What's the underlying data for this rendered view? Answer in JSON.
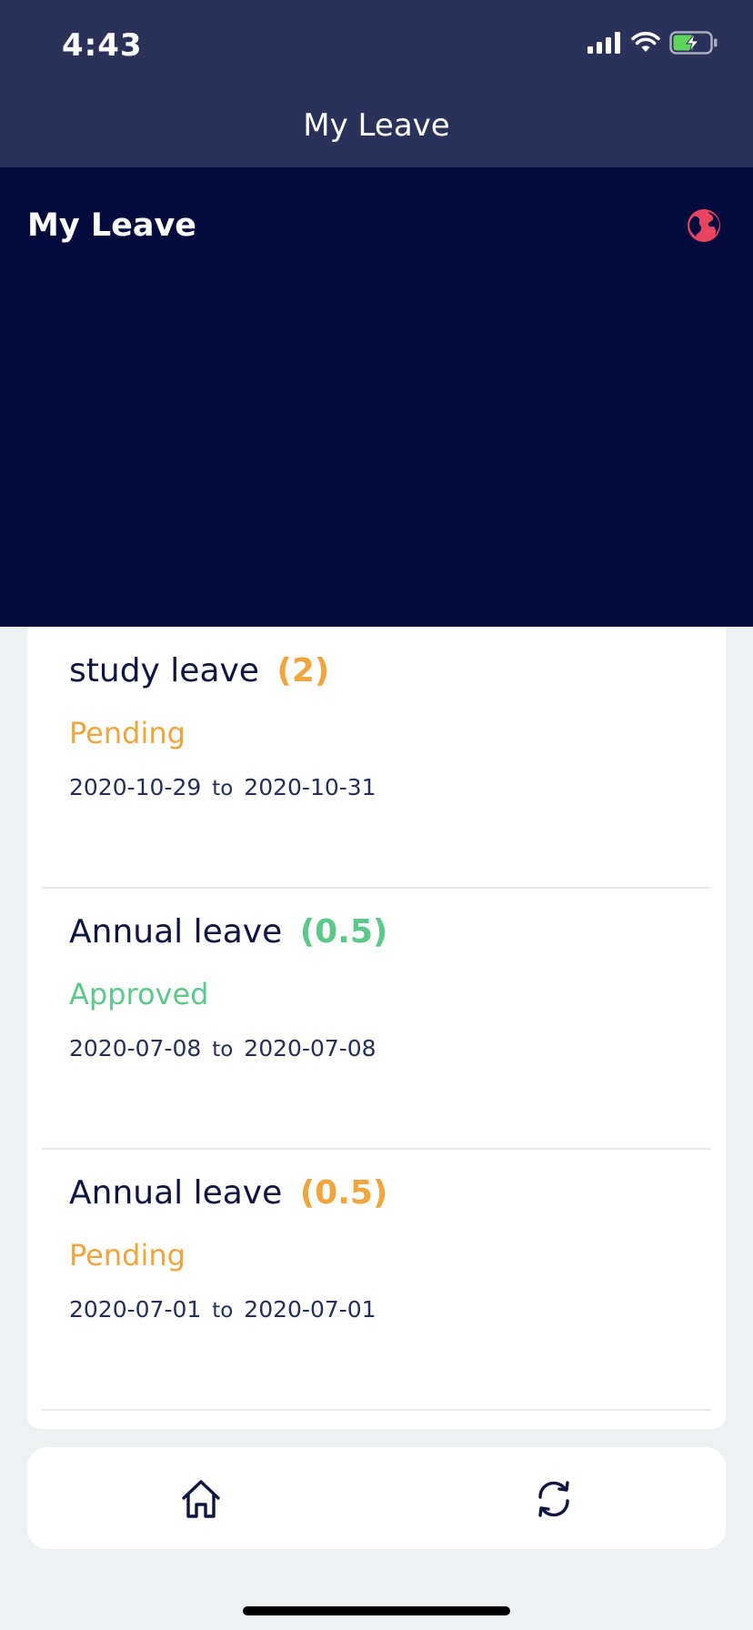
{
  "status_bar": {
    "time": "4:43",
    "icons": [
      "signal-icon",
      "wifi-icon",
      "battery-charging-icon"
    ]
  },
  "nav": {
    "title": "My Leave"
  },
  "hero": {
    "title": "My Leave",
    "action_icon": "globe-icon"
  },
  "colors": {
    "accent_pending": "#f0a53e",
    "accent_approved": "#5cc98a",
    "navy": "#030b3d",
    "nav_bar": "#2b325a",
    "globe": "#e94461"
  },
  "leaves": [
    {
      "type": "study leave",
      "count": "(2)",
      "status": "Pending",
      "start": "2020-10-29",
      "sep": "to",
      "end": "2020-10-31"
    },
    {
      "type": "Annual leave",
      "count": "(0.5)",
      "status": "Approved",
      "start": "2020-07-08",
      "sep": "to",
      "end": "2020-07-08"
    },
    {
      "type": "Annual leave",
      "count": "(0.5)",
      "status": "Pending",
      "start": "2020-07-01",
      "sep": "to",
      "end": "2020-07-01"
    }
  ],
  "tabbar": {
    "items": [
      "home-icon",
      "refresh-icon"
    ]
  }
}
